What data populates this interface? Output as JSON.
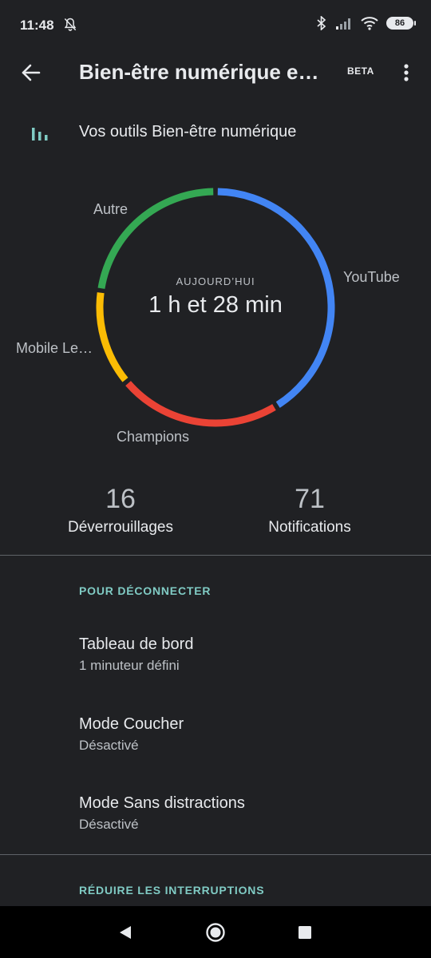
{
  "status_bar": {
    "time": "11:48",
    "battery": "86",
    "icons": [
      "bell-off-icon",
      "bluetooth-icon",
      "signal-icon",
      "wifi-icon",
      "battery-icon"
    ]
  },
  "app_bar": {
    "title": "Bien-être numérique et contrôle parental",
    "badge": "BETA",
    "back_icon": "arrow-back-icon",
    "menu_icon": "more-vert-icon"
  },
  "tools": {
    "label": "Vos outils Bien-être numérique",
    "icon": "bar-chart-icon"
  },
  "usage_chart": {
    "center_caption": "AUJOURD’HUI",
    "total": "1 h et 28 min",
    "segments": [
      {
        "label": "YouTube",
        "color": "#4285f4",
        "share": 0.4
      },
      {
        "label": "Champions",
        "color": "#ea4335",
        "share": 0.22
      },
      {
        "label": "Mobile Le…",
        "color": "#fbbc04",
        "share": 0.13
      },
      {
        "label": "Autre",
        "color": "#34a853",
        "share": 0.22
      }
    ]
  },
  "stats": {
    "unlocks_value": "16",
    "unlocks_label": "Déverrouillages",
    "notifications_value": "71",
    "notifications_label": "Notifications"
  },
  "disconnect_section": {
    "heading": "POUR DÉCONNECTER",
    "items": [
      {
        "title": "Tableau de bord",
        "subtitle": "1 minuteur défini"
      },
      {
        "title": "Mode Coucher",
        "subtitle": "Désactivé"
      },
      {
        "title": "Mode Sans distractions",
        "subtitle": "Désactivé"
      }
    ]
  },
  "interruptions_section": {
    "heading": "RÉDUIRE LES INTERRUPTIONS"
  },
  "nav_bar": {
    "back_icon": "nav-back-icon",
    "home_icon": "nav-home-icon",
    "recents_icon": "nav-recents-icon"
  },
  "colors": {
    "background": "#202124",
    "accent": "#80cbc4",
    "text_primary": "#e8eaed",
    "text_secondary": "#bdc1c6"
  }
}
